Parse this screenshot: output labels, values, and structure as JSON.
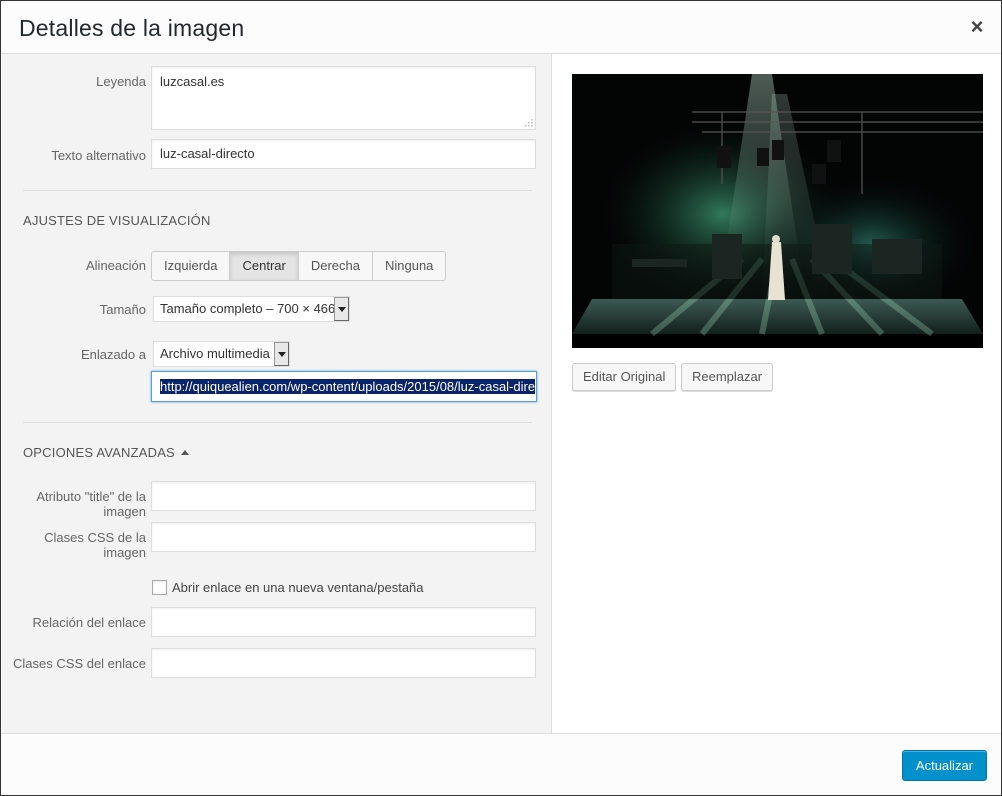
{
  "header": {
    "title": "Detalles de la imagen",
    "close_glyph": "×"
  },
  "fields": {
    "caption": {
      "label": "Leyenda",
      "value": "luzcasal.es"
    },
    "alt_text": {
      "label": "Texto alternativo",
      "value": "luz-casal-directo"
    }
  },
  "display_settings": {
    "title": "Ajustes de visualización",
    "alignment": {
      "label": "Alineación",
      "options": [
        "Izquierda",
        "Centrar",
        "Derecha",
        "Ninguna"
      ],
      "selected": "Centrar"
    },
    "size": {
      "label": "Tamaño",
      "value": "Tamaño completo – 700 × 466"
    },
    "link_to": {
      "label": "Enlazado a",
      "value": "Archivo multimedia",
      "url": "http://quiquealien.com/wp-content/uploads/2015/08/luz-casal-dire"
    }
  },
  "advanced": {
    "title": "Opciones avanzadas",
    "image_title": {
      "label_line1": "Atributo \"title\" de la",
      "label_line2": "imagen",
      "value": ""
    },
    "image_css": {
      "label_line1": "Clases CSS de la",
      "label_line2": "imagen",
      "value": ""
    },
    "new_tab": {
      "label": "Abrir enlace en una nueva ventana/pestaña",
      "checked": false
    },
    "link_rel": {
      "label": "Relación del enlace",
      "value": ""
    },
    "link_css": {
      "label": "Clases CSS del enlace",
      "value": ""
    }
  },
  "preview": {
    "edit_original_label": "Editar Original",
    "replace_label": "Reemplazar"
  },
  "footer": {
    "update_label": "Actualizar"
  },
  "colors": {
    "primary": "#0091cd",
    "selection": "#0a246a",
    "focus_border": "#5b9dd9"
  },
  "icons": [
    "close-icon",
    "resize-grip-icon",
    "chevron-down-icon",
    "triangle-up-icon",
    "checkbox-icon"
  ]
}
